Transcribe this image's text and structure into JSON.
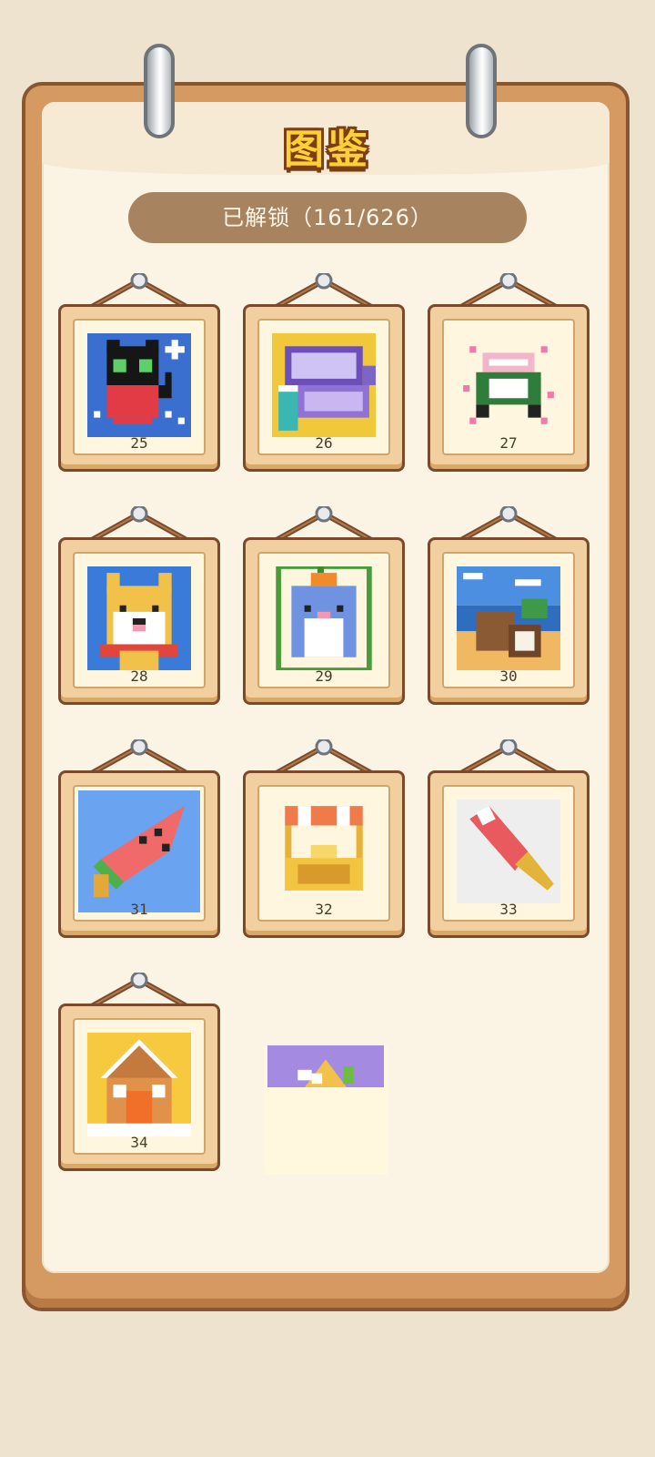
{
  "title": "图鉴",
  "unlocked": "已解锁（161/626）",
  "frames": [
    {
      "number": "25",
      "icon": "black-cat-strawberry"
    },
    {
      "number": "26",
      "icon": "laptop-and-drink"
    },
    {
      "number": "27",
      "icon": "green-van"
    },
    {
      "number": "28",
      "icon": "shiba-dog"
    },
    {
      "number": "29",
      "icon": "hamster-pumpkin"
    },
    {
      "number": "30",
      "icon": "coconuts-beach"
    },
    {
      "number": "31",
      "icon": "watermelon-popsicle"
    },
    {
      "number": "32",
      "icon": "food-stall"
    },
    {
      "number": "33",
      "icon": "ice-lolly"
    },
    {
      "number": "34",
      "icon": "gingerbread-house"
    }
  ],
  "colors": {
    "background": "#ede3cf",
    "board": "#d49a62",
    "paper": "#fbf3e4",
    "pill": "#a8835f",
    "title": "#ffcf3a"
  }
}
